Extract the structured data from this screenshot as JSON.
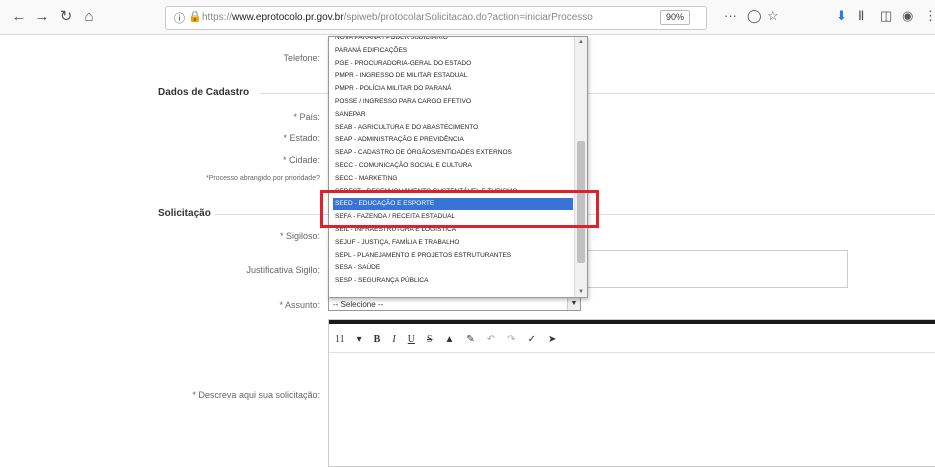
{
  "browser": {
    "url_domain": "www.eprotocolo.pr.gov.br",
    "url_prefix": "https://",
    "url_path": "/spiweb/protocolarSolicitacao.do?action=iniciarProcesso",
    "zoom": "90%",
    "more": "···"
  },
  "form": {
    "telefone_label": "Telefone:",
    "section_cadastro": "Dados de Cadastro",
    "pais_label": "* País:",
    "estado_label": "* Estado:",
    "cidade_label": "* Cidade:",
    "prioridade_label": "*Processo abrangido por prioridade?",
    "section_solicitacao": "Solicitação",
    "sigiloso_label": "* Sigiloso:",
    "justificativa_label": "Justificativa Sigilo:",
    "assunto_label": "* Assunto:",
    "assunto_value": "-- Selecione --",
    "descreva_label": "* Descreva aqui sua solicitação:"
  },
  "editor": {
    "font_size": "11"
  },
  "dropdown": {
    "items": [
      "NOVA PARANÁ / PODER JUDICIÁRIO",
      "PARANÁ EDIFICAÇÕES",
      "PGE - PROCURADORIA-GERAL DO ESTADO",
      "PMPR - INGRESSO DE MILITAR ESTADUAL",
      "PMPR - POLÍCIA MILITAR DO PARANÁ",
      "POSSE / INGRESSO PARA CARGO EFETIVO",
      "SANEPAR",
      "SEAB - AGRICULTURA E DO ABASTECIMENTO",
      "SEAP - ADMINISTRAÇÃO E PREVIDÊNCIA",
      "SEAP - CADASTRO DE ÓRGÃOS/ENTIDADES EXTERNOS",
      "SECC - COMUNICAÇÃO SOCIAL E CULTURA",
      "SECC - MARKETING",
      "SEDEST - DESENVOLVIMENTO SUSTENTÁVEL E TURISMO",
      "SEED - EDUCAÇÃO E ESPORTE",
      "SEFA - FAZENDA / RECEITA ESTADUAL",
      "SEIL - INFRAESTRUTURA E LOGÍSTICA",
      "SEJUF - JUSTIÇA, FAMÍLIA E TRABALHO",
      "SEPL - PLANEJAMENTO E PROJETOS ESTRUTURANTES",
      "SESA - SAÚDE",
      "SESP - SEGURANÇA PÚBLICA"
    ],
    "selected_index": 13,
    "highlight_color": "#e0202a",
    "selected_color": "#3874d8"
  }
}
